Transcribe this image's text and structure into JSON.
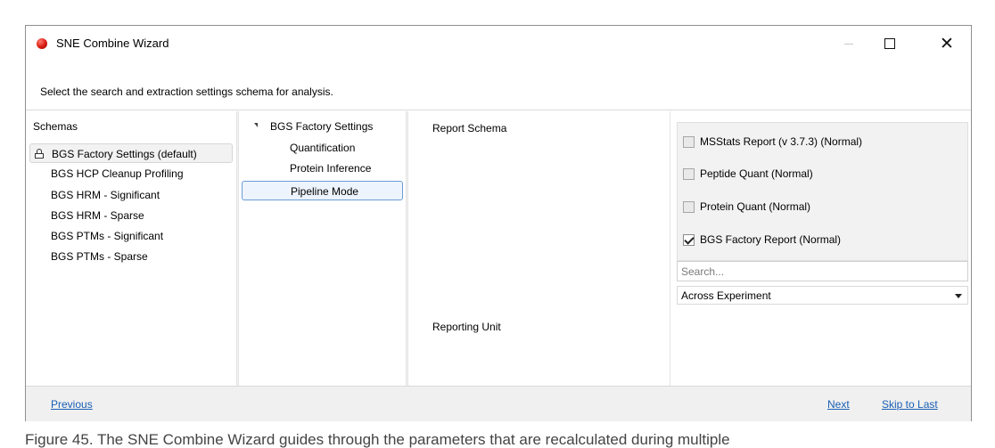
{
  "window": {
    "title": "SNE Combine Wizard",
    "icon": "sne-app-icon",
    "controls": {
      "minimize": "minimize-icon",
      "maximize": "maximize-icon",
      "close": "✕"
    }
  },
  "instruction": "Select the search and extraction settings schema for  analysis.",
  "schemas": {
    "header": "Schemas",
    "items": [
      {
        "label": "BGS Factory Settings (default)",
        "selected": true,
        "locked": true
      },
      {
        "label": "BGS HCP Cleanup Profiling"
      },
      {
        "label": "BGS HRM - Significant"
      },
      {
        "label": "BGS HRM - Sparse"
      },
      {
        "label": "BGS PTMs - Significant"
      },
      {
        "label": "BGS PTMs - Sparse"
      }
    ]
  },
  "tree": {
    "root": "BGS Factory Settings",
    "children": [
      {
        "label": "Quantification"
      },
      {
        "label": "Protein Inference"
      },
      {
        "label": "Pipeline Mode",
        "selected": true
      }
    ]
  },
  "settings": {
    "report_schema_label": "Report Schema",
    "reports": [
      {
        "label": "MSStats Report (v 3.7.3) (Normal)",
        "checked": false
      },
      {
        "label": "Peptide Quant (Normal)",
        "checked": false
      },
      {
        "label": "Protein Quant (Normal)",
        "checked": false
      },
      {
        "label": "BGS Factory Report (Normal)",
        "checked": true
      }
    ],
    "search_placeholder": "Search...",
    "reporting_unit_label": "Reporting Unit",
    "reporting_unit_value": "Across Experiment"
  },
  "footer": {
    "previous": "Previous",
    "next": "Next",
    "skip": "Skip to Last"
  },
  "caption": "Figure 45. The SNE Combine Wizard guides through the parameters that are recalculated during multiple",
  "colors": {
    "link": "#1a5fb4",
    "selection_border": "#6b9bd8",
    "selection_fill": "#edf4fd"
  }
}
